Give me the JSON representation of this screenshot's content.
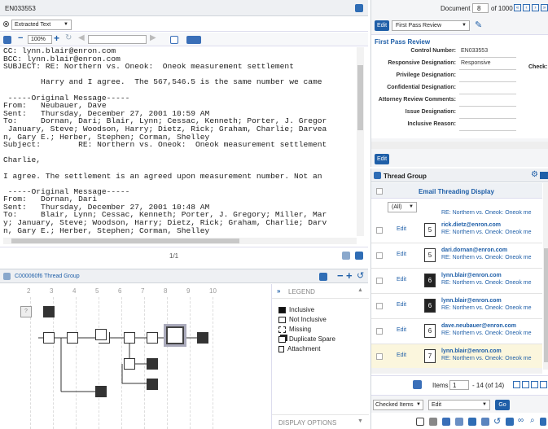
{
  "doc_id": "EN033553",
  "viewer": {
    "view_mode": "Extracted Text",
    "zoom": "100%",
    "page_indicator": "1/1",
    "email_lines": [
      "CC: lynn.blair@enron.com",
      "BCC: lynn.blair@enron.com",
      "SUBJECT: RE: Northern vs. Oneok:  Oneok measurement settlement",
      "",
      "        Harry and I agree.  The 567,546.5 is the same number we came",
      "",
      " -----Original Message-----",
      "From:   Neubauer, Dave",
      "Sent:   Thursday, December 27, 2001 10:59 AM",
      "To:     Dornan, Dari; Blair, Lynn; Cessac, Kenneth; Porter, J. Gregor",
      " January, Steve; Woodson, Harry; Dietz, Rick; Graham, Charlie; Darvea",
      "n, Gary E.; Herber, Stephen; Corman, Shelley",
      "Subject:        RE: Northern vs. Oneok:  Oneok measurement settlement",
      "",
      "Charlie,",
      "",
      "I agree. The settlement is an agreed upon measurement number. Not an",
      "",
      " -----Original Message-----",
      "From:   Dornan, Dari",
      "Sent:   Thursday, December 27, 2001 10:48 AM",
      "To:     Blair, Lynn; Cessac, Kenneth; Porter, J. Gregory; Miller, Mar",
      "y; January, Steve; Woodson, Harry; Dietz, Rick; Graham, Charlie; Darv",
      "n, Gary E.; Herber, Stephen; Corman, Shelley"
    ]
  },
  "thread_panel": {
    "title": "C000060f6 Thread Group",
    "columns": [
      "2",
      "3",
      "4",
      "5",
      "6",
      "7",
      "8",
      "9",
      "10"
    ],
    "legend_title": "LEGEND",
    "legend": [
      {
        "label": "Inclusive",
        "icon": "filled-square-icon"
      },
      {
        "label": "Not Inclusive",
        "icon": "empty-square-icon"
      },
      {
        "label": "Missing",
        "icon": "missing-icon"
      },
      {
        "label": "Duplicate Spare",
        "icon": "duplicate-icon"
      },
      {
        "label": "Attachment",
        "icon": "attachment-icon"
      }
    ],
    "display_options": "DISPLAY OPTIONS"
  },
  "coding": {
    "document_label": "Document",
    "document_number": "8",
    "document_total": "of 1000",
    "edit_label": "Edit",
    "layout": "First Pass Review",
    "section_title": "First Pass Review",
    "fields": [
      {
        "label": "Control Number:",
        "value": "EN033553"
      },
      {
        "label": "Responsive Designation:",
        "value": "Responsive"
      },
      {
        "label": "Privilege Designation:",
        "value": ""
      },
      {
        "label": "Confidential Designation:",
        "value": ""
      },
      {
        "label": "Attorney Review Comments:",
        "value": ""
      },
      {
        "label": "Issue Designation:",
        "value": ""
      },
      {
        "label": "Inclusive Reason:",
        "value": ""
      }
    ],
    "check_label": "Check:",
    "bottom_edit": "Edit"
  },
  "thread_group": {
    "title": "Thread Group",
    "column_header": "Email Threading Display",
    "filter": "(All)",
    "partial_subject": "RE: Northern vs. Oneok: Oneok me",
    "rows": [
      {
        "num": "5",
        "dark": false,
        "email": "rick.dietz@enron.com",
        "subject": "RE: Northern vs. Oneok: Oneok me"
      },
      {
        "num": "5",
        "dark": false,
        "email": "dari.dornan@enron.com",
        "subject": "RE: Northern vs. Oneok: Oneok me"
      },
      {
        "num": "6",
        "dark": true,
        "email": "lynn.blair@enron.com",
        "subject": "RE: Northern vs. Oneok: Oneok me"
      },
      {
        "num": "6",
        "dark": true,
        "email": "lynn.blair@enron.com",
        "subject": "RE: Northern vs. Oneok: Oneok me"
      },
      {
        "num": "6",
        "dark": false,
        "email": "dave.neubauer@enron.com",
        "subject": "RE: Northern vs. Oneok: Oneok me"
      },
      {
        "num": "7",
        "dark": false,
        "email": "lynn.blair@enron.com",
        "subject": "RE: Northern vs. Oneok: Oneok me"
      }
    ],
    "edit_label": "Edit",
    "items_label": "Items",
    "items_from": "1",
    "items_range": "- 14 (of 14)",
    "mass_scope": "Checked Items",
    "mass_action": "Edit",
    "go_label": "Go"
  }
}
